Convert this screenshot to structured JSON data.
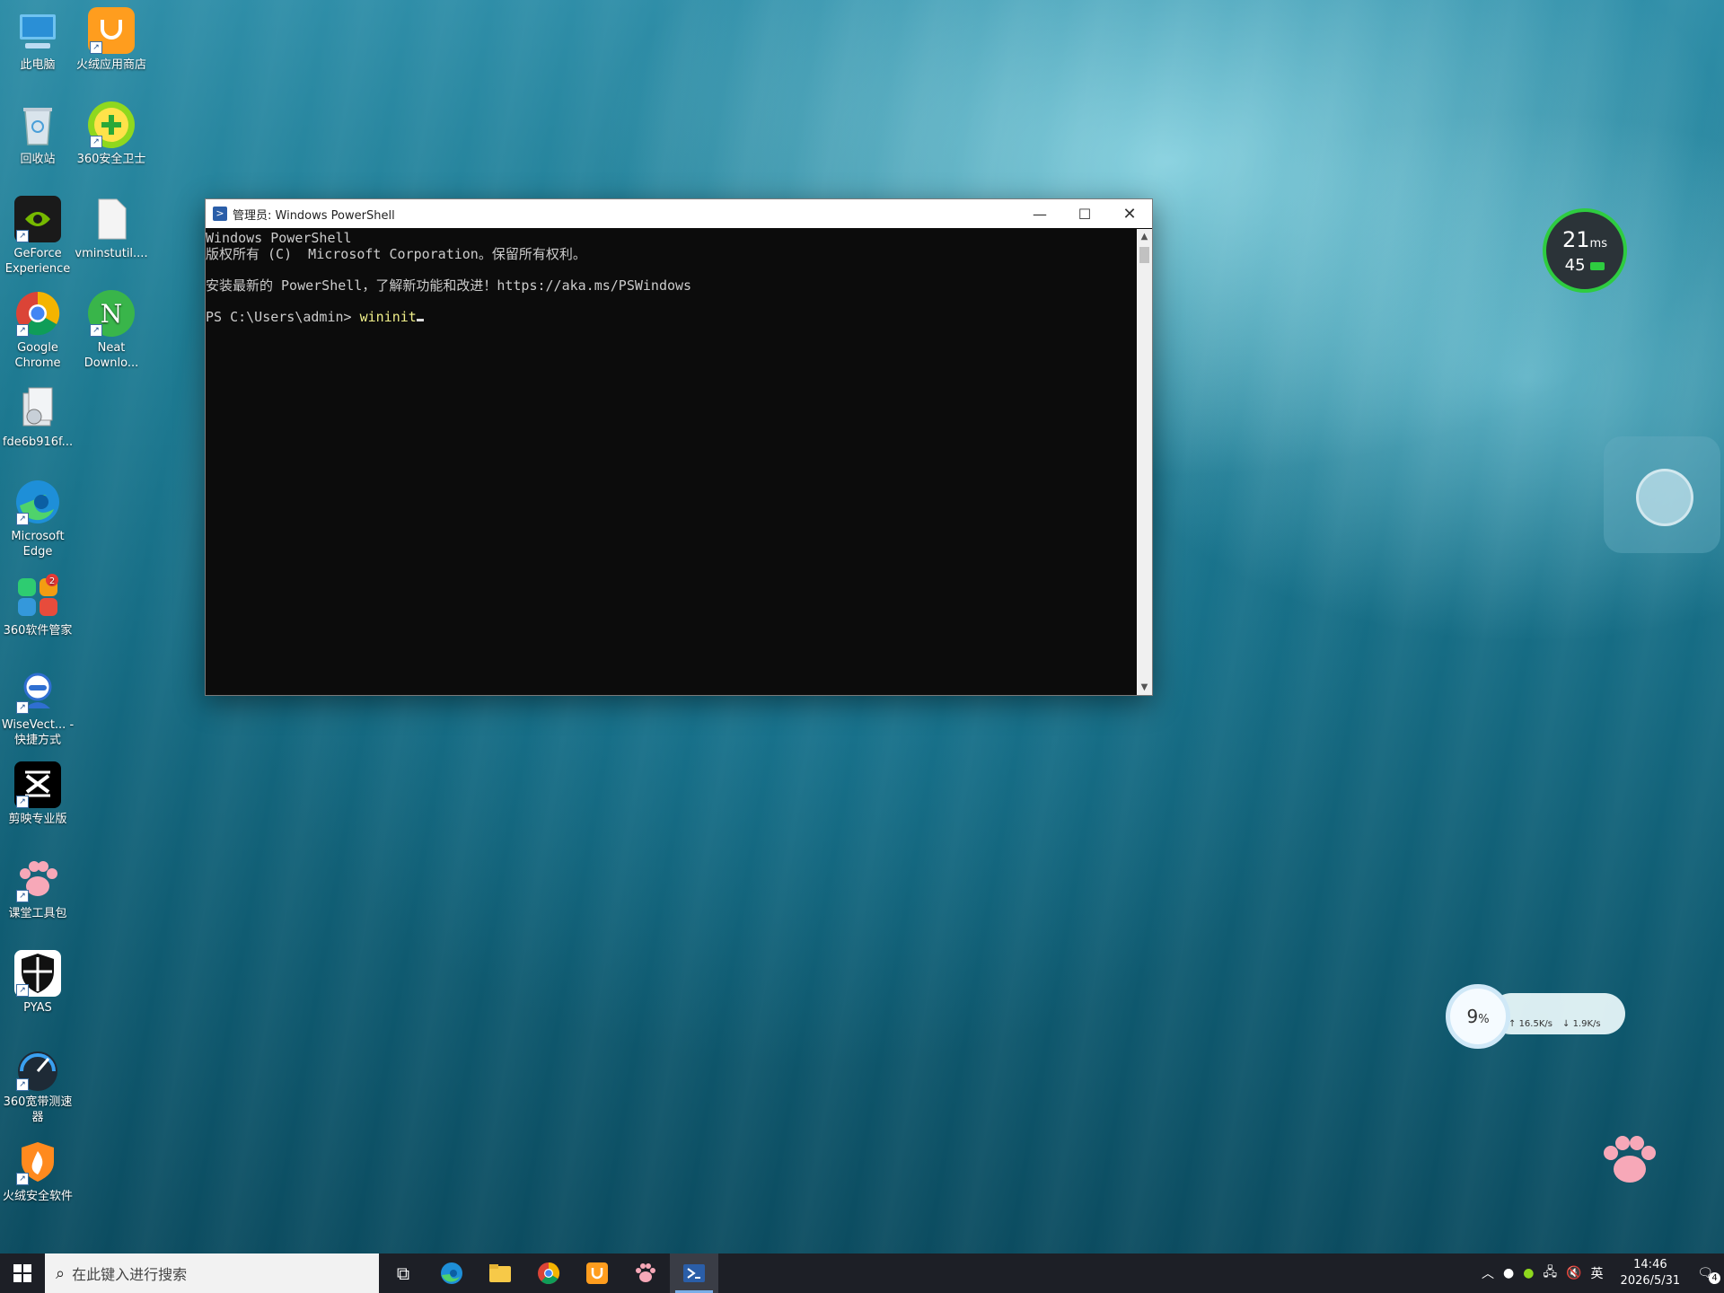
{
  "desktop": {
    "icons": [
      {
        "label": "此电脑"
      },
      {
        "label": "火绒应用商店"
      },
      {
        "label": "回收站"
      },
      {
        "label": "360安全卫士"
      },
      {
        "label": "GeForce Experience"
      },
      {
        "label": "vminstutil...."
      },
      {
        "label": "Google Chrome"
      },
      {
        "label": "Neat Downlo..."
      },
      {
        "label": "fde6b916f..."
      },
      {
        "label": "Microsoft Edge"
      },
      {
        "label": "360软件管家"
      },
      {
        "label": "WiseVect... - 快捷方式"
      },
      {
        "label": "剪映专业版"
      },
      {
        "label": "课堂工具包"
      },
      {
        "label": "PYAS"
      },
      {
        "label": "360宽带测速器"
      },
      {
        "label": "火绒安全软件"
      }
    ]
  },
  "powershell": {
    "title": "管理员: Windows PowerShell",
    "lines": [
      "Windows PowerShell",
      "版权所有 (C)  Microsoft Corporation。保留所有权利。",
      "",
      "安装最新的 PowerShell，了解新功能和改进！https://aka.ms/PSWindows",
      ""
    ],
    "prompt": "PS C:\\Users\\admin> ",
    "command": "wininit"
  },
  "widgets": {
    "ping": {
      "ms": "21",
      "ms_unit": "ms",
      "fps": "45"
    },
    "network": {
      "cpu": "9",
      "cpu_unit": "%",
      "upload": "16.5K/s",
      "download": "1.9K/s"
    }
  },
  "taskbar": {
    "search_placeholder": "在此键入进行搜索",
    "input_lang": "英",
    "time": "14:46",
    "date": "2026/5/31",
    "notification_count": "4"
  },
  "colors": {
    "accent": "#2a5ea8",
    "taskbar": "#1d1f26",
    "terminal_bg": "#0c0c0c"
  }
}
